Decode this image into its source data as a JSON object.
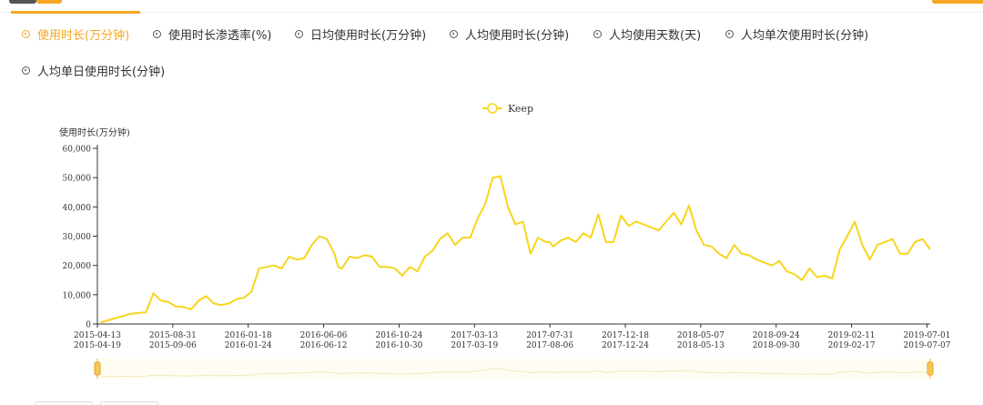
{
  "tabs": [
    {
      "label": "使用时长(万分钟)",
      "active": true
    },
    {
      "label": "使用时长渗透率(%)",
      "active": false
    },
    {
      "label": "日均使用时长(万分钟)",
      "active": false
    },
    {
      "label": "人均使用时长(分钟)",
      "active": false
    },
    {
      "label": "人均使用天数(天)",
      "active": false
    },
    {
      "label": "人均单次使用时长(分钟)",
      "active": false
    },
    {
      "label": "人均单日使用时长(分钟)",
      "active": false
    }
  ],
  "colors": {
    "accent": "#f5a623",
    "series": "#f7d51d"
  },
  "chart_data": {
    "type": "line",
    "ylabel": "使用时长(万分钟)",
    "ylim": [
      0,
      60000
    ],
    "yticks": [
      0,
      10000,
      20000,
      30000,
      40000,
      50000,
      60000
    ],
    "ytick_labels": [
      "0",
      "10,000",
      "20,000",
      "30,000",
      "40,000",
      "50,000",
      "60,000"
    ],
    "xlim": [
      "2015-04-13",
      "2019-07-07"
    ],
    "xticks_top": [
      "2015-04-13",
      "2015-08-31",
      "2016-01-18",
      "2016-06-06",
      "2016-10-24",
      "2017-03-13",
      "2017-07-31",
      "2017-12-18",
      "2018-05-07",
      "2018-09-24",
      "2019-02-11",
      "2019-07-01"
    ],
    "xticks_bottom": [
      "2015-04-19",
      "2015-09-06",
      "2016-01-24",
      "2016-06-12",
      "2016-10-30",
      "2017-03-19",
      "2017-08-06",
      "2017-12-24",
      "2018-05-13",
      "2018-09-30",
      "2019-02-17",
      "2019-07-07"
    ],
    "legend": {
      "position": "top-center"
    },
    "series": [
      {
        "name": "Keep",
        "x": [
          "2015-04-19",
          "2015-05-17",
          "2015-06-14",
          "2015-07-12",
          "2015-07-26",
          "2015-08-09",
          "2015-08-23",
          "2015-09-06",
          "2015-09-20",
          "2015-10-04",
          "2015-10-18",
          "2015-11-01",
          "2015-11-15",
          "2015-11-29",
          "2015-12-13",
          "2015-12-27",
          "2016-01-10",
          "2016-01-24",
          "2016-02-07",
          "2016-02-21",
          "2016-03-06",
          "2016-03-20",
          "2016-04-03",
          "2016-04-17",
          "2016-05-01",
          "2016-05-15",
          "2016-05-29",
          "2016-06-12",
          "2016-06-26",
          "2016-07-03",
          "2016-07-10",
          "2016-07-24",
          "2016-08-07",
          "2016-08-21",
          "2016-09-04",
          "2016-09-18",
          "2016-10-02",
          "2016-10-16",
          "2016-10-30",
          "2016-11-13",
          "2016-11-27",
          "2016-12-11",
          "2016-12-25",
          "2017-01-08",
          "2017-01-22",
          "2017-02-05",
          "2017-02-19",
          "2017-03-05",
          "2017-03-19",
          "2017-04-02",
          "2017-04-16",
          "2017-04-30",
          "2017-05-14",
          "2017-05-28",
          "2017-06-11",
          "2017-06-25",
          "2017-07-09",
          "2017-07-23",
          "2017-07-30",
          "2017-08-06",
          "2017-08-20",
          "2017-09-03",
          "2017-09-17",
          "2017-10-01",
          "2017-10-15",
          "2017-10-29",
          "2017-11-12",
          "2017-11-26",
          "2017-12-10",
          "2017-12-24",
          "2018-01-07",
          "2018-01-21",
          "2018-02-04",
          "2018-02-18",
          "2018-03-04",
          "2018-03-18",
          "2018-04-01",
          "2018-04-15",
          "2018-04-29",
          "2018-05-13",
          "2018-05-27",
          "2018-06-10",
          "2018-06-24",
          "2018-07-08",
          "2018-07-22",
          "2018-08-05",
          "2018-08-19",
          "2018-09-02",
          "2018-09-16",
          "2018-09-30",
          "2018-10-14",
          "2018-10-28",
          "2018-11-11",
          "2018-11-25",
          "2018-12-09",
          "2018-12-23",
          "2019-01-06",
          "2019-01-20",
          "2019-02-03",
          "2019-02-17",
          "2019-03-03",
          "2019-03-17",
          "2019-03-31",
          "2019-04-14",
          "2019-04-28",
          "2019-05-12",
          "2019-05-26",
          "2019-06-09",
          "2019-06-23",
          "2019-07-07"
        ],
        "values": [
          600,
          2000,
          3500,
          4000,
          10500,
          8000,
          7500,
          6000,
          5800,
          5000,
          8000,
          9500,
          7000,
          6500,
          7000,
          8500,
          9000,
          11000,
          19000,
          19500,
          20000,
          19000,
          23000,
          22000,
          22500,
          27000,
          30000,
          29000,
          24000,
          19500,
          19000,
          23000,
          22500,
          23500,
          23000,
          19500,
          19500,
          19000,
          16500,
          19500,
          18000,
          23000,
          25000,
          29000,
          31000,
          27000,
          29500,
          29500,
          36000,
          41000,
          50000,
          50500,
          40000,
          34000,
          35000,
          24000,
          29500,
          28000,
          28000,
          26500,
          28500,
          29500,
          28000,
          31000,
          29500,
          37500,
          28000,
          28000,
          37000,
          33500,
          35000,
          34000,
          33000,
          32000,
          35000,
          38000,
          34000,
          40500,
          32000,
          27000,
          26500,
          24000,
          22500,
          27000,
          24000,
          23500,
          22000,
          21000,
          20000,
          21500,
          18000,
          17000,
          15000,
          19000,
          16000,
          16500,
          15500,
          25500,
          30000,
          35000,
          27000,
          22000,
          27000,
          28000,
          29000,
          24000,
          24000,
          28000,
          29000,
          25500
        ]
      }
    ]
  }
}
